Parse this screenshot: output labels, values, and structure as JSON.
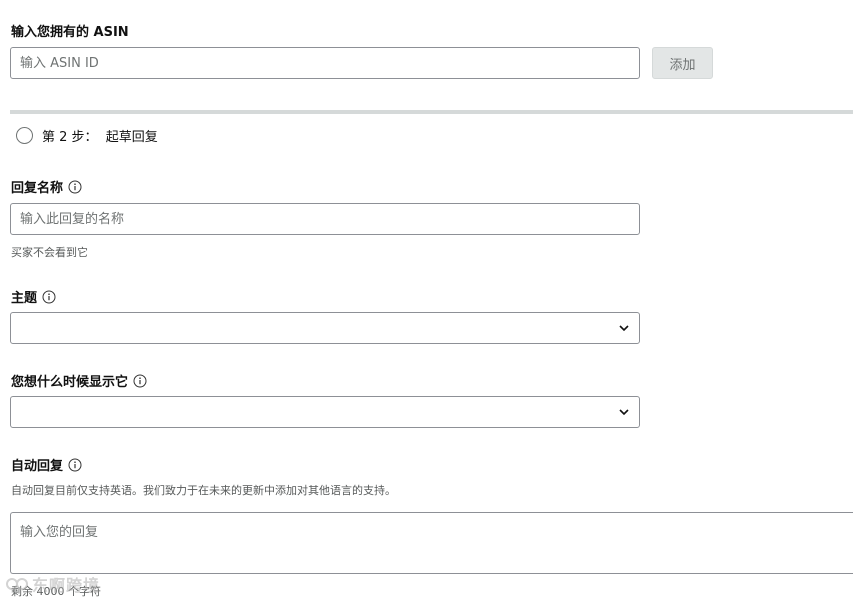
{
  "asin": {
    "label": "输入您拥有的 ASIN",
    "placeholder": "输入 ASIN ID",
    "add_button": "添加"
  },
  "step": {
    "prefix": "第 2 步：",
    "title": "起草回复"
  },
  "reply_name": {
    "label": "回复名称",
    "placeholder": "输入此回复的名称",
    "help": "买家不会看到它"
  },
  "subject": {
    "label": "主题",
    "selected": ""
  },
  "display_time": {
    "label": "您想什么时候显示它",
    "selected": ""
  },
  "auto_reply": {
    "label": "自动回复",
    "help": "自动回复目前仅支持英语。我们致力于在未来的更新中添加对其他语言的支持。",
    "placeholder": "输入您的回复",
    "counter": "剩余 4000 个字符"
  },
  "watermark": {
    "text": "东啊跨境"
  },
  "icons": {
    "info": "info-icon",
    "select": "chevron-down-icon",
    "radio": "radio-circle-icon"
  }
}
